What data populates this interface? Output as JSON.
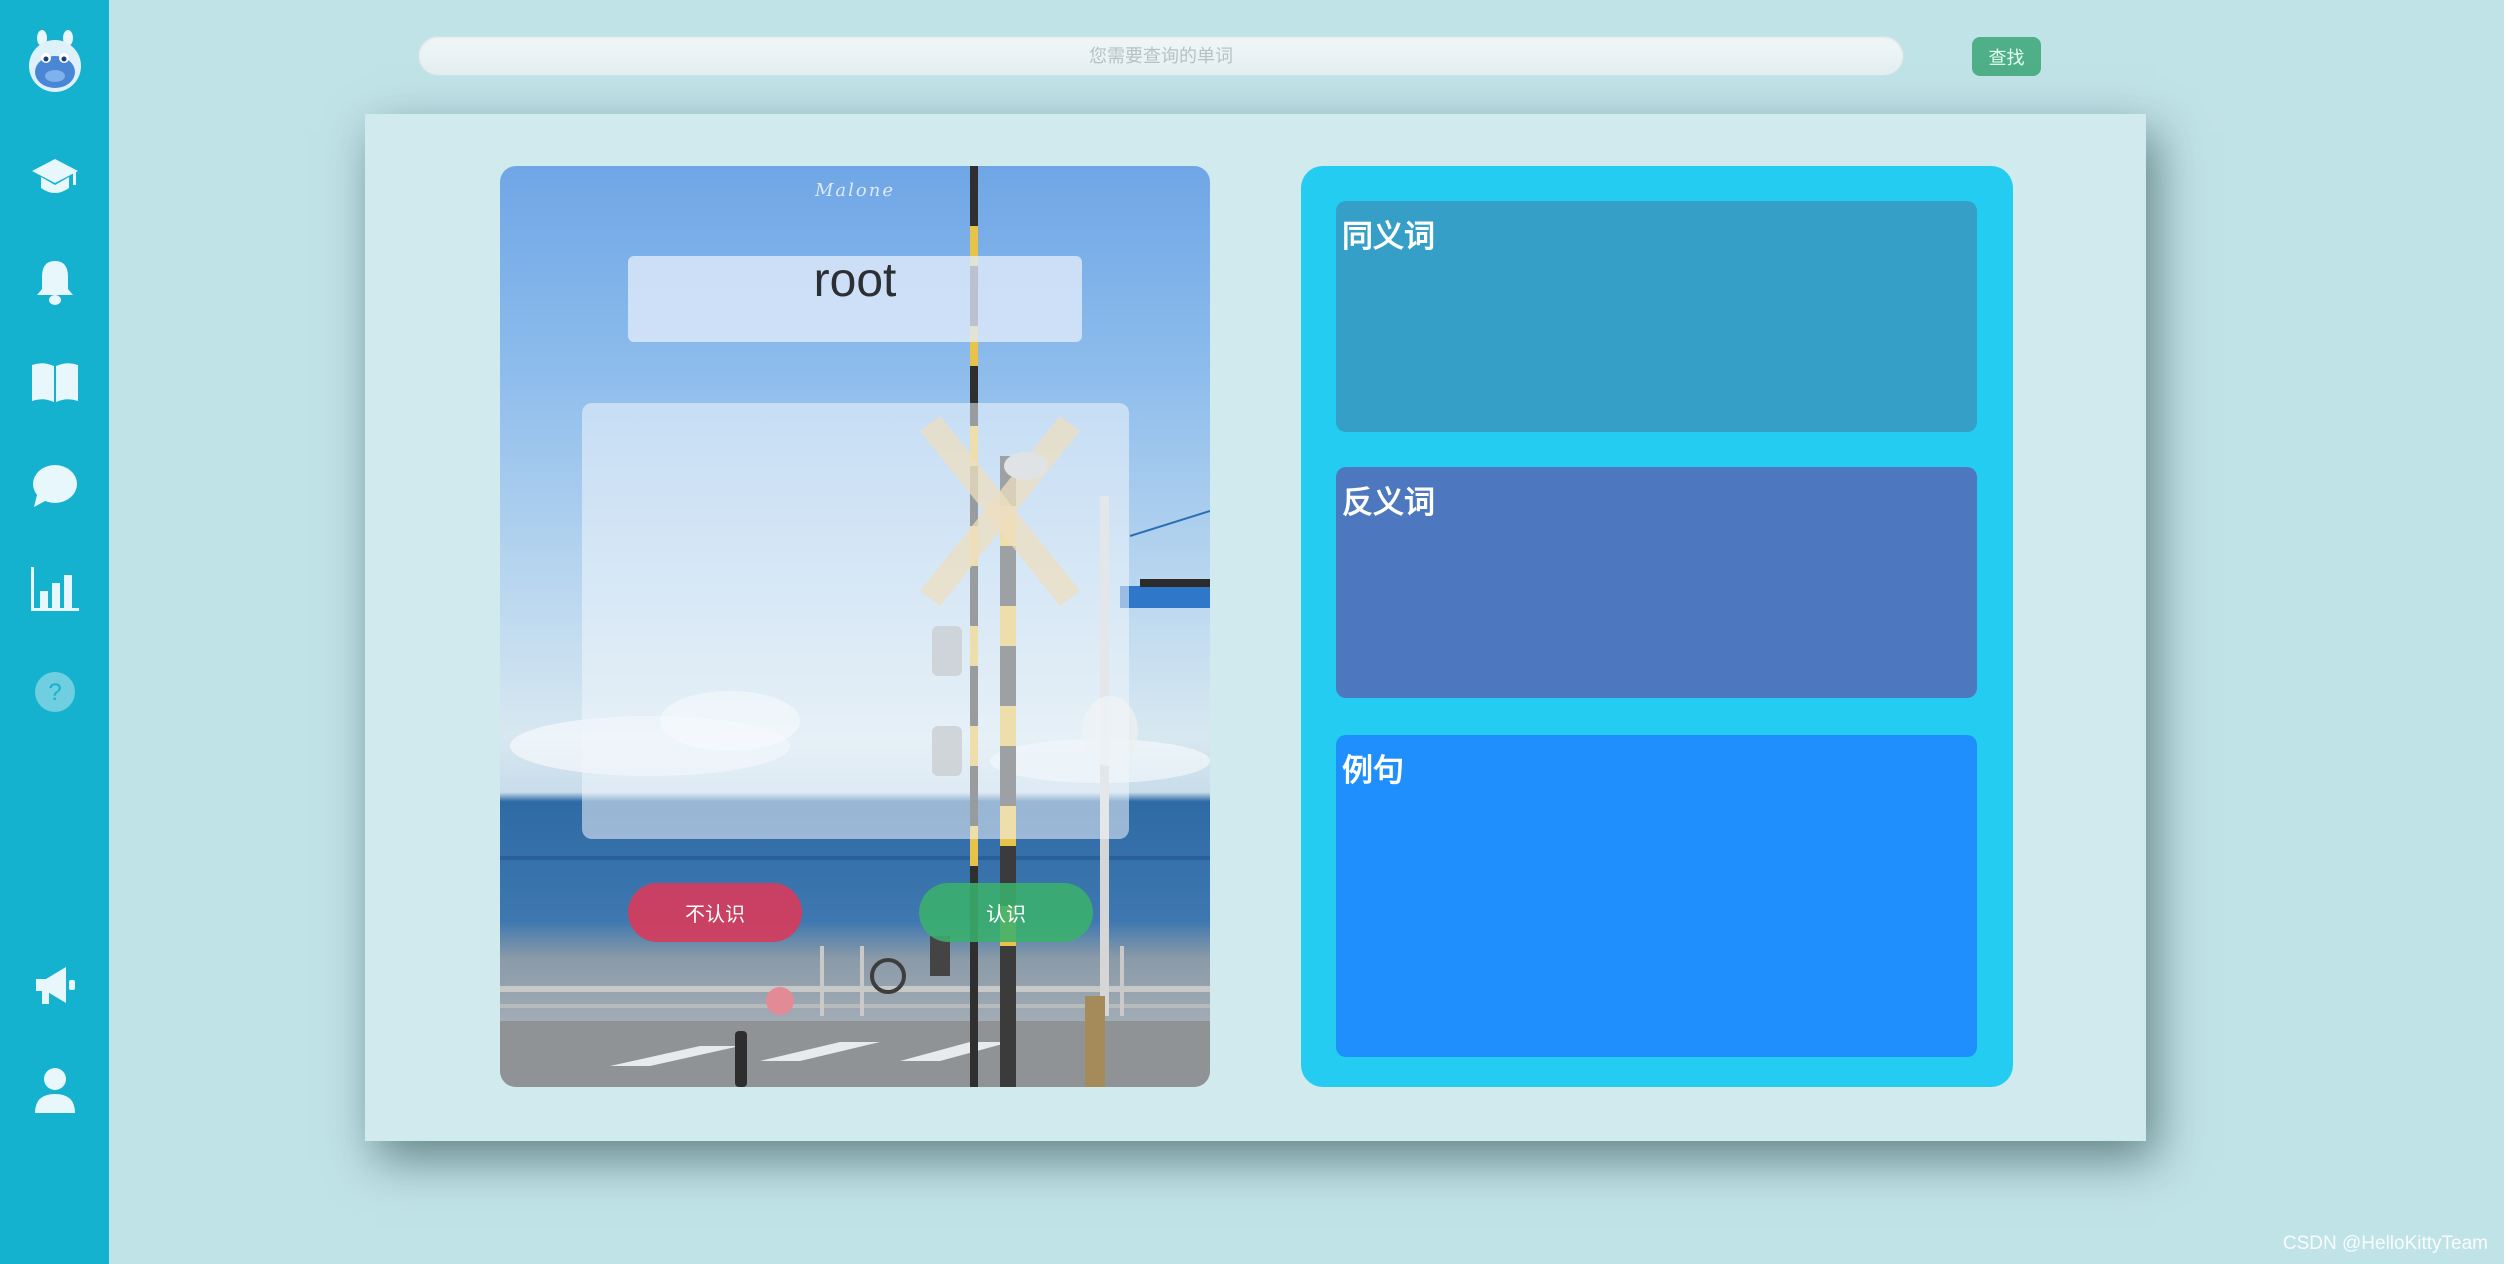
{
  "sidebar": {
    "items": [
      {
        "icon": "mascot-logo-icon"
      },
      {
        "icon": "graduation-cap-icon"
      },
      {
        "icon": "bell-icon"
      },
      {
        "icon": "book-icon"
      },
      {
        "icon": "chat-bubble-icon"
      },
      {
        "icon": "bar-chart-icon"
      },
      {
        "icon": "help-icon"
      },
      {
        "icon": "megaphone-icon"
      },
      {
        "icon": "user-icon"
      }
    ]
  },
  "search": {
    "placeholder": "您需要查询的单词",
    "button_label": "查找"
  },
  "card": {
    "watermark": "Malone",
    "word": "root",
    "meaning": "",
    "unknown_label": "不认识",
    "known_label": "认识"
  },
  "info": {
    "synonym_title": "同义词",
    "antonym_title": "反义词",
    "example_title": "例句"
  },
  "footer": {
    "credit": "CSDN @HelloKittyTeam"
  },
  "colors": {
    "sidebar": "#14b2cf",
    "background": "#c0e3e8",
    "panel": "#d1eaee",
    "info_panel": "#23ccf0",
    "synonym_box": "#369fc8",
    "antonym_box": "#4d78bf",
    "example_box": "#1f8ffe",
    "unknown_button": "#d53c5c",
    "known_button": "#3ab06c",
    "search_button": "#4fb087"
  }
}
